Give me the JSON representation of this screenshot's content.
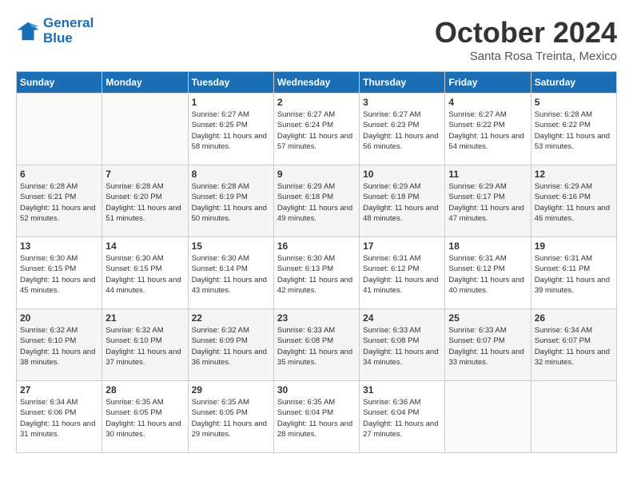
{
  "header": {
    "logo_line1": "General",
    "logo_line2": "Blue",
    "month": "October 2024",
    "location": "Santa Rosa Treinta, Mexico"
  },
  "days_of_week": [
    "Sunday",
    "Monday",
    "Tuesday",
    "Wednesday",
    "Thursday",
    "Friday",
    "Saturday"
  ],
  "weeks": [
    [
      {
        "day": "",
        "empty": true
      },
      {
        "day": "",
        "empty": true
      },
      {
        "day": "1",
        "sunrise": "6:27 AM",
        "sunset": "6:25 PM",
        "daylight": "11 hours and 58 minutes."
      },
      {
        "day": "2",
        "sunrise": "6:27 AM",
        "sunset": "6:24 PM",
        "daylight": "11 hours and 57 minutes."
      },
      {
        "day": "3",
        "sunrise": "6:27 AM",
        "sunset": "6:23 PM",
        "daylight": "11 hours and 56 minutes."
      },
      {
        "day": "4",
        "sunrise": "6:27 AM",
        "sunset": "6:22 PM",
        "daylight": "11 hours and 54 minutes."
      },
      {
        "day": "5",
        "sunrise": "6:28 AM",
        "sunset": "6:22 PM",
        "daylight": "11 hours and 53 minutes."
      }
    ],
    [
      {
        "day": "6",
        "sunrise": "6:28 AM",
        "sunset": "6:21 PM",
        "daylight": "11 hours and 52 minutes."
      },
      {
        "day": "7",
        "sunrise": "6:28 AM",
        "sunset": "6:20 PM",
        "daylight": "11 hours and 51 minutes."
      },
      {
        "day": "8",
        "sunrise": "6:28 AM",
        "sunset": "6:19 PM",
        "daylight": "11 hours and 50 minutes."
      },
      {
        "day": "9",
        "sunrise": "6:29 AM",
        "sunset": "6:18 PM",
        "daylight": "11 hours and 49 minutes."
      },
      {
        "day": "10",
        "sunrise": "6:29 AM",
        "sunset": "6:18 PM",
        "daylight": "11 hours and 48 minutes."
      },
      {
        "day": "11",
        "sunrise": "6:29 AM",
        "sunset": "6:17 PM",
        "daylight": "11 hours and 47 minutes."
      },
      {
        "day": "12",
        "sunrise": "6:29 AM",
        "sunset": "6:16 PM",
        "daylight": "11 hours and 46 minutes."
      }
    ],
    [
      {
        "day": "13",
        "sunrise": "6:30 AM",
        "sunset": "6:15 PM",
        "daylight": "11 hours and 45 minutes."
      },
      {
        "day": "14",
        "sunrise": "6:30 AM",
        "sunset": "6:15 PM",
        "daylight": "11 hours and 44 minutes."
      },
      {
        "day": "15",
        "sunrise": "6:30 AM",
        "sunset": "6:14 PM",
        "daylight": "11 hours and 43 minutes."
      },
      {
        "day": "16",
        "sunrise": "6:30 AM",
        "sunset": "6:13 PM",
        "daylight": "11 hours and 42 minutes."
      },
      {
        "day": "17",
        "sunrise": "6:31 AM",
        "sunset": "6:12 PM",
        "daylight": "11 hours and 41 minutes."
      },
      {
        "day": "18",
        "sunrise": "6:31 AM",
        "sunset": "6:12 PM",
        "daylight": "11 hours and 40 minutes."
      },
      {
        "day": "19",
        "sunrise": "6:31 AM",
        "sunset": "6:11 PM",
        "daylight": "11 hours and 39 minutes."
      }
    ],
    [
      {
        "day": "20",
        "sunrise": "6:32 AM",
        "sunset": "6:10 PM",
        "daylight": "11 hours and 38 minutes."
      },
      {
        "day": "21",
        "sunrise": "6:32 AM",
        "sunset": "6:10 PM",
        "daylight": "11 hours and 37 minutes."
      },
      {
        "day": "22",
        "sunrise": "6:32 AM",
        "sunset": "6:09 PM",
        "daylight": "11 hours and 36 minutes."
      },
      {
        "day": "23",
        "sunrise": "6:33 AM",
        "sunset": "6:08 PM",
        "daylight": "11 hours and 35 minutes."
      },
      {
        "day": "24",
        "sunrise": "6:33 AM",
        "sunset": "6:08 PM",
        "daylight": "11 hours and 34 minutes."
      },
      {
        "day": "25",
        "sunrise": "6:33 AM",
        "sunset": "6:07 PM",
        "daylight": "11 hours and 33 minutes."
      },
      {
        "day": "26",
        "sunrise": "6:34 AM",
        "sunset": "6:07 PM",
        "daylight": "11 hours and 32 minutes."
      }
    ],
    [
      {
        "day": "27",
        "sunrise": "6:34 AM",
        "sunset": "6:06 PM",
        "daylight": "11 hours and 31 minutes."
      },
      {
        "day": "28",
        "sunrise": "6:35 AM",
        "sunset": "6:05 PM",
        "daylight": "11 hours and 30 minutes."
      },
      {
        "day": "29",
        "sunrise": "6:35 AM",
        "sunset": "6:05 PM",
        "daylight": "11 hours and 29 minutes."
      },
      {
        "day": "30",
        "sunrise": "6:35 AM",
        "sunset": "6:04 PM",
        "daylight": "11 hours and 28 minutes."
      },
      {
        "day": "31",
        "sunrise": "6:36 AM",
        "sunset": "6:04 PM",
        "daylight": "11 hours and 27 minutes."
      },
      {
        "day": "",
        "empty": true
      },
      {
        "day": "",
        "empty": true
      }
    ]
  ]
}
